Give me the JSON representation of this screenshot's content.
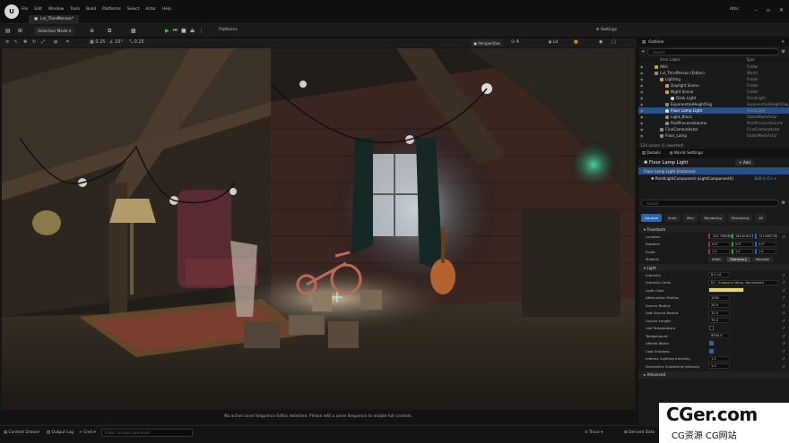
{
  "menu": [
    "File",
    "Edit",
    "Window",
    "Tools",
    "Build",
    "Platforms",
    "Select",
    "Actor",
    "Help"
  ],
  "tab": {
    "label": "Lvl_ThirdPerson*"
  },
  "project": "Attic",
  "toolbar": {
    "mode_label": "Selection Mode",
    "platforms_label": "Platforms",
    "settings_label": "Settings"
  },
  "viewport": {
    "perspective": "Perspective",
    "lit": "Lit",
    "grid_value": "0.25",
    "angle_value": "10°",
    "scale_value": "0.25",
    "camera_speed": "4"
  },
  "sequence_message": "No active Level Sequence Editor detected. Please edit a Level Sequence to enable full controls.",
  "status": {
    "content_drawer": "Content Drawer",
    "output_log": "Output Log",
    "cmd": "Cmd",
    "cmd_placeholder": "Enter Console Command",
    "trace": "Trace",
    "derived_data": "Derived Data",
    "all_saved": "All Saved",
    "revision": "Revision Control"
  },
  "outliner": {
    "title": "Outliner",
    "search_placeholder": "Search",
    "col_label": "Item Label",
    "col_type": "Type",
    "items": [
      {
        "name": "Attic",
        "type": "Folder",
        "indent": 0,
        "kind": "f"
      },
      {
        "name": "Lvl_ThirdPerson (Editor)",
        "type": "World",
        "indent": 0,
        "kind": "a"
      },
      {
        "name": "Lighting",
        "type": "Folder",
        "indent": 1,
        "kind": "f"
      },
      {
        "name": "Daylight Scene",
        "type": "Folder",
        "indent": 2,
        "kind": "f"
      },
      {
        "name": "Night Scene",
        "type": "Folder",
        "indent": 2,
        "kind": "f"
      },
      {
        "name": "Desk Light",
        "type": "PointLight",
        "indent": 3,
        "kind": "l"
      },
      {
        "name": "ExponentialHeightFog",
        "type": "ExponentialHeightFog",
        "indent": 2,
        "kind": "a"
      },
      {
        "name": "Floor Lamp Light",
        "type": "PointLight",
        "indent": 2,
        "kind": "l",
        "selected": true
      },
      {
        "name": "Light_Block",
        "type": "StaticMeshActor",
        "indent": 2,
        "kind": "a"
      },
      {
        "name": "PostProcessVolume",
        "type": "PostProcessVolume",
        "indent": 2,
        "kind": "a"
      },
      {
        "name": "CineCameraActor",
        "type": "CineCameraActor",
        "indent": 1,
        "kind": "a"
      },
      {
        "name": "Floor_Lamp",
        "type": "StaticMeshActor",
        "indent": 1,
        "kind": "a"
      }
    ],
    "count": "124 actors (1 selected)"
  },
  "details": {
    "tab1": "Details",
    "tab2": "World Settings",
    "actor_name": "Floor Lamp Light",
    "add_label": "+ Add",
    "instance": "Floor Lamp Light (Instance)",
    "component": "PointLightComponent (LightComponent0)",
    "edit_cpp": "Edit in C++",
    "search_placeholder": "Search",
    "filters": [
      "General",
      "Actor",
      "Misc",
      "Rendering",
      "Streaming",
      "All"
    ],
    "transform_label": "Transform",
    "location": {
      "label": "Location",
      "x": "-301.798049",
      "y": "164.818027",
      "z": "123.860778"
    },
    "rotation": {
      "label": "Rotation",
      "x": "0.0°",
      "y": "0.0°",
      "z": "0.0°"
    },
    "scale": {
      "label": "Scale",
      "x": "1.0",
      "y": "1.0",
      "z": "1.0"
    },
    "mobility": {
      "label": "Mobility",
      "opts": [
        "Static",
        "Stationary",
        "Movable"
      ]
    },
    "light_label": "Light",
    "props": [
      {
        "k": "Intensity",
        "v": "8.0 cd",
        "type": "text"
      },
      {
        "k": "Intensity Units",
        "v": "EV - Exposure Value, Normalized",
        "type": "text"
      },
      {
        "k": "Light Color",
        "v": "",
        "type": "color"
      },
      {
        "k": "Attenuation Radius",
        "v": "1000",
        "type": "text"
      },
      {
        "k": "Source Radius",
        "v": "26.0",
        "type": "text"
      },
      {
        "k": "Soft Source Radius",
        "v": "15.0",
        "type": "text"
      },
      {
        "k": "Source Length",
        "v": "75.0",
        "type": "text"
      },
      {
        "k": "Use Temperature",
        "v": "",
        "type": "check"
      },
      {
        "k": "Temperature",
        "v": "6500.0",
        "type": "text"
      },
      {
        "k": "Affects World",
        "v": "",
        "type": "checkon"
      },
      {
        "k": "Cast Shadows",
        "v": "",
        "type": "checkon"
      },
      {
        "k": "Indirect Lighting Intensity",
        "v": "1.0",
        "type": "text"
      },
      {
        "k": "Volumetric Scattering Intensity",
        "v": "1.0",
        "type": "text"
      }
    ],
    "advanced": "Advanced"
  },
  "watermark": {
    "big": "CGer.com",
    "small": "CG资源 CG网站"
  },
  "colors": {
    "selection": "#2b4f86",
    "accent": "#2b66b5",
    "light_color": "#e7d76e"
  }
}
